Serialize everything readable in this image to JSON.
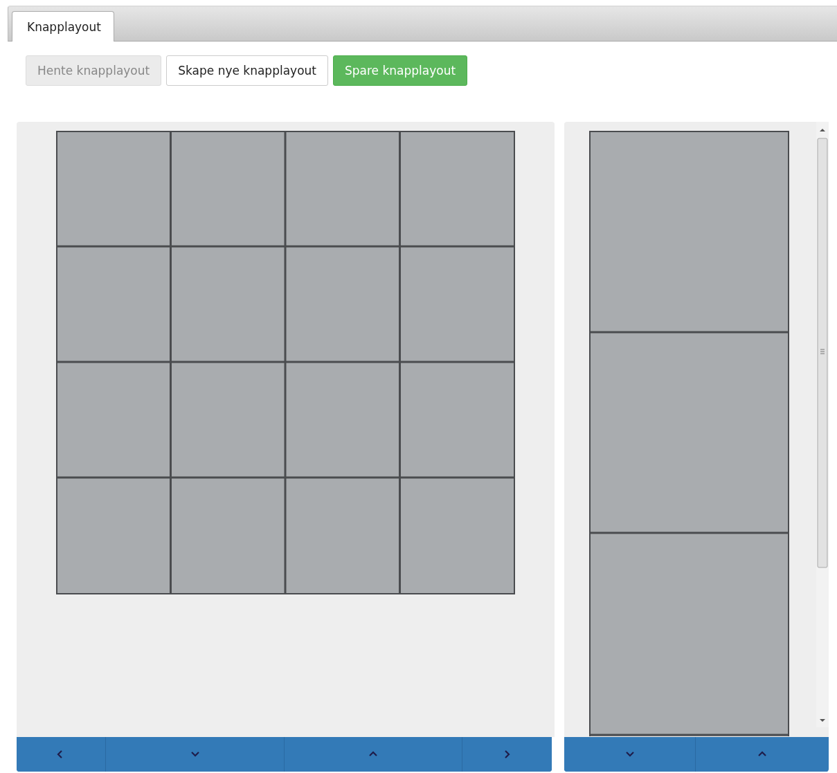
{
  "tabs": [
    {
      "label": "Knapplayout",
      "selected": true
    }
  ],
  "toolbar": [
    {
      "label": "Hente knapplayout",
      "kind": "default",
      "disabled": true
    },
    {
      "label": "Skape nye knapplayout",
      "kind": "default",
      "disabled": false
    },
    {
      "label": "Spare knapplayout",
      "kind": "success",
      "disabled": false
    }
  ],
  "main_nav": [
    {
      "kind": "left"
    },
    {
      "kind": "down"
    },
    {
      "kind": "up"
    },
    {
      "kind": "right"
    }
  ],
  "side_nav": [
    {
      "kind": "down"
    },
    {
      "kind": "up"
    }
  ]
}
